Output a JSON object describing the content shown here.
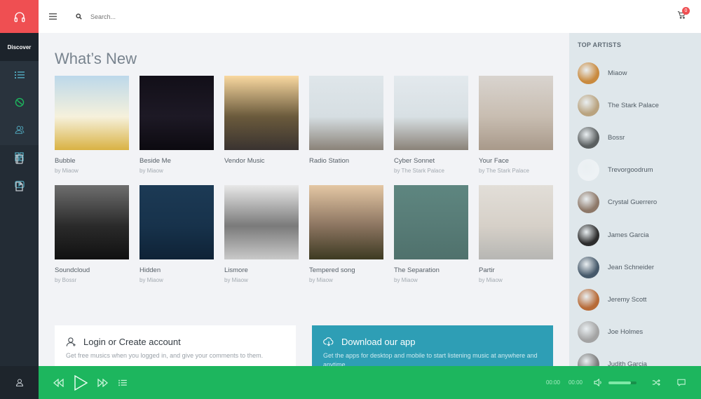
{
  "nav": {
    "brand_icon": "headphones-icon",
    "discover_label": "Discover",
    "items": [
      {
        "icon": "list-icon"
      },
      {
        "icon": "disc-icon",
        "active": true
      },
      {
        "icon": "users-icon"
      },
      {
        "icon": "grid-icon"
      },
      {
        "icon": "video-icon"
      },
      {
        "icon": "tablet-icon"
      },
      {
        "icon": "document-icon"
      }
    ],
    "profile_icon": "user-icon"
  },
  "header": {
    "search_placeholder": "Search...",
    "cart_count": "0"
  },
  "main": {
    "title": "What’s New",
    "albums": [
      {
        "title": "Bubble",
        "artist": "by Miaow",
        "colors": [
          "#bcd8ea",
          "#f6f1dc",
          "#d9b243"
        ]
      },
      {
        "title": "Beside Me",
        "artist": "by Miaow",
        "colors": [
          "#120f18",
          "#1d1925",
          "#0c0a10"
        ]
      },
      {
        "title": "Vendor Music",
        "artist": "",
        "colors": [
          "#f9d8a0",
          "#6a5a3c",
          "#3a3330"
        ]
      },
      {
        "title": "Radio Station",
        "artist": "",
        "colors": [
          "#dfe6ea",
          "#d6dee2",
          "#8a8278"
        ]
      },
      {
        "title": "Cyber Sonnet",
        "artist": "by The Stark Palace",
        "colors": [
          "#e3e9ed",
          "#d8e0e4",
          "#8a8278"
        ]
      },
      {
        "title": "Your Face",
        "artist": "by The Stark Palace",
        "colors": [
          "#d9d4cf",
          "#c8bdb1",
          "#a8998a"
        ]
      },
      {
        "title": "Soundcloud",
        "artist": "by Bossr",
        "colors": [
          "#6e6e6e",
          "#2a2a2a",
          "#111111"
        ]
      },
      {
        "title": "Hidden",
        "artist": "by Miaow",
        "colors": [
          "#1c3a55",
          "#17324b",
          "#0e2236"
        ]
      },
      {
        "title": "Lismore",
        "artist": "by Miaow",
        "colors": [
          "#e8e8e8",
          "#7a7a7a",
          "#c9c9c9"
        ]
      },
      {
        "title": "Tempered song",
        "artist": "by Miaow",
        "colors": [
          "#e4c7a4",
          "#8b7460",
          "#3d3a22"
        ]
      },
      {
        "title": "The Separation",
        "artist": "by Miaow",
        "colors": [
          "#5e8680",
          "#577b76",
          "#4f716c"
        ]
      },
      {
        "title": "Partir",
        "artist": "by Miaow",
        "colors": [
          "#e2ded8",
          "#d6d0c8",
          "#b6b6b3"
        ]
      }
    ],
    "login_panel": {
      "title": "Login or Create account",
      "description": "Get free musics when you logged in, and give your comments to them."
    },
    "download_panel": {
      "title": "Download our app",
      "description": "Get the apps for desktop and mobile to start listening music at anywhere and anytime."
    }
  },
  "sidebar": {
    "heading": "TOP ARTISTS",
    "artists": [
      {
        "name": "Miaow",
        "color": "#c98a3e"
      },
      {
        "name": "The Stark Palace",
        "color": "#b9a37f"
      },
      {
        "name": "Bossr",
        "color": "#5a5f60"
      },
      {
        "name": "Trevorgoodrum",
        "color": "#eef2f5"
      },
      {
        "name": "Crystal Guerrero",
        "color": "#8d7868"
      },
      {
        "name": "James Garcia",
        "color": "#2d2d2d"
      },
      {
        "name": "Jean Schneider",
        "color": "#46596a"
      },
      {
        "name": "Jeremy Scott",
        "color": "#b76b38"
      },
      {
        "name": "Joe Holmes",
        "color": "#a3a3a3"
      },
      {
        "name": "Judith Garcia",
        "color": "#7b7b7b"
      }
    ]
  },
  "player": {
    "current_time": "00:00",
    "duration": "00:00",
    "volume_percent": 80,
    "colors": {
      "bar": "#1db65e"
    }
  }
}
